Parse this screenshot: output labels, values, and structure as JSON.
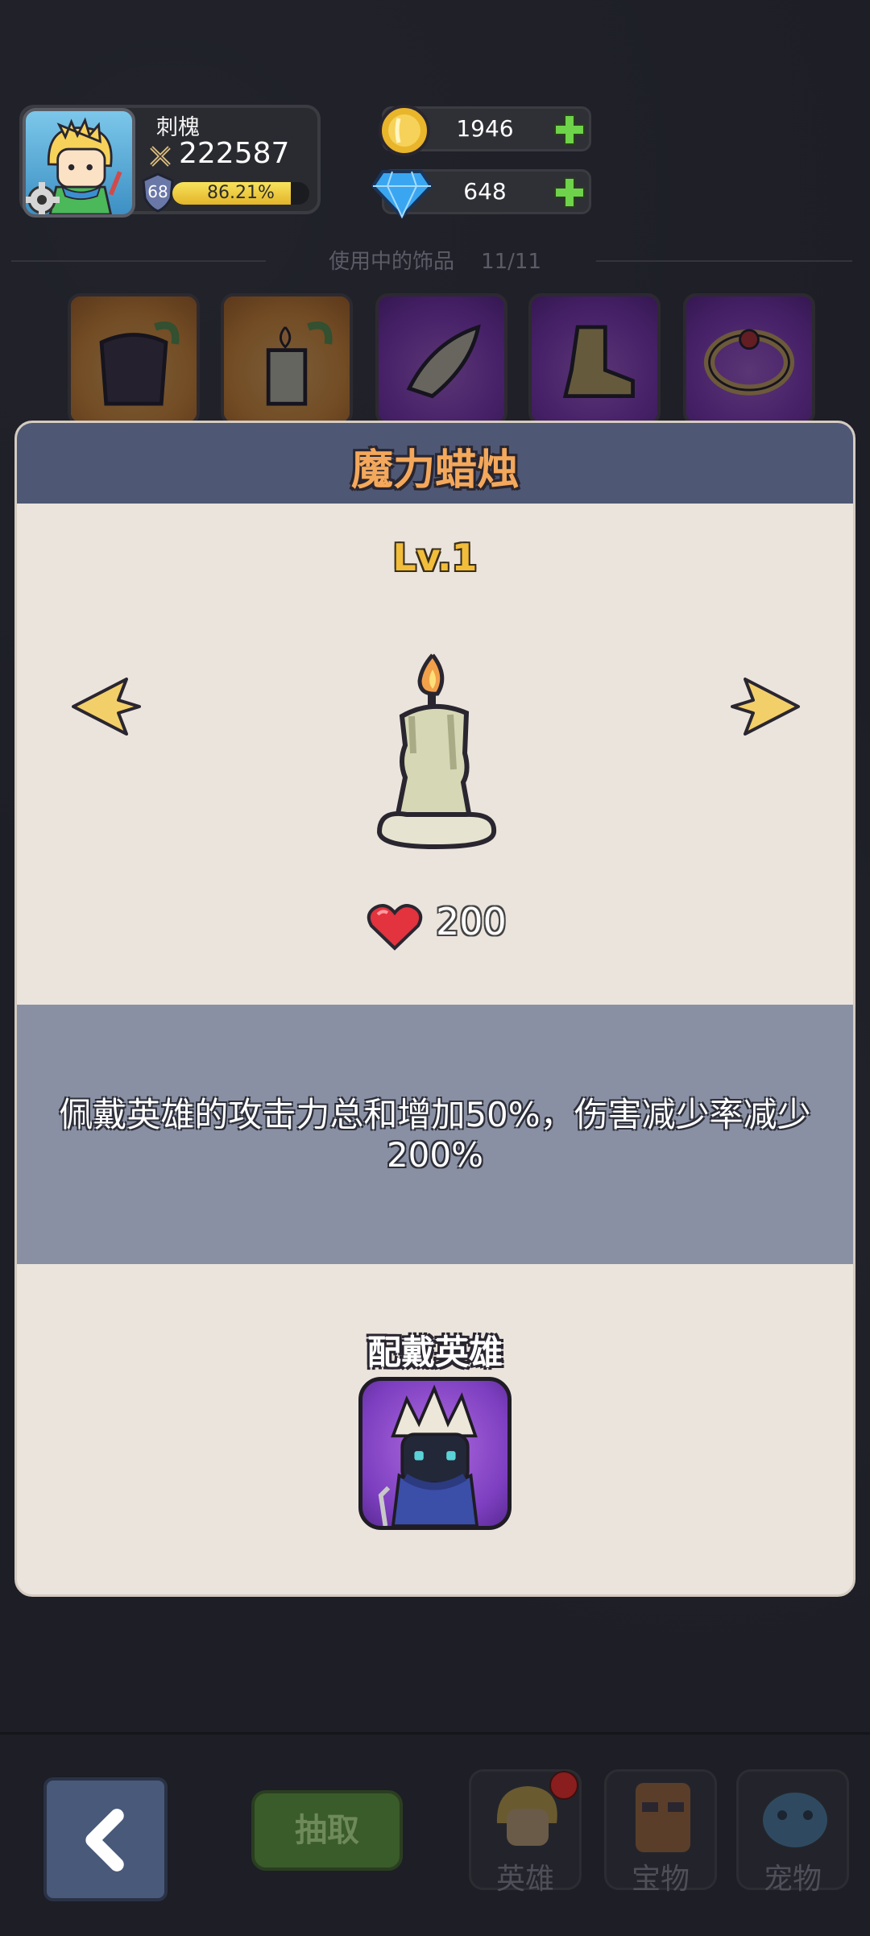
{
  "player": {
    "name": "刺槐",
    "power": "222587",
    "level": "68",
    "xp_percent": "86.21%",
    "xp_fraction": 0.8621
  },
  "currency": {
    "gold": "1946",
    "gems": "648"
  },
  "accessories": {
    "section_label": "使用中的饰品",
    "count": "11/11",
    "slots": [
      {
        "icon": "cloak-icon",
        "rarity": "orange"
      },
      {
        "icon": "candle-icon",
        "rarity": "orange"
      },
      {
        "icon": "horn-icon",
        "rarity": "purple"
      },
      {
        "icon": "boot-icon",
        "rarity": "purple"
      },
      {
        "icon": "ring-icon",
        "rarity": "purple"
      }
    ]
  },
  "detail": {
    "title": "魔力蜡烛",
    "level": "Lv.1",
    "stat_icon": "heart-icon",
    "stat_value": "200",
    "description": "佩戴英雄的攻击力总和增加50%，伤害减少率减少200%",
    "hero_label": "配戴英雄",
    "hero_icon": "ninja-hero-portrait"
  },
  "bottom_nav": {
    "back_icon": "chevron-left-icon",
    "draw_label": "抽取",
    "tabs": [
      {
        "label": "英雄",
        "icon": "hero-icon",
        "badge": true
      },
      {
        "label": "宝物",
        "icon": "treasure-icon",
        "badge": false
      },
      {
        "label": "宠物",
        "icon": "pet-icon",
        "badge": false
      }
    ]
  },
  "colors": {
    "title_orange": "#f4a85b",
    "level_gold": "#f1bd3a",
    "panel_header": "#4e5875",
    "desc_band": "#8a90a3",
    "panel_bg": "#ebe4dd"
  }
}
